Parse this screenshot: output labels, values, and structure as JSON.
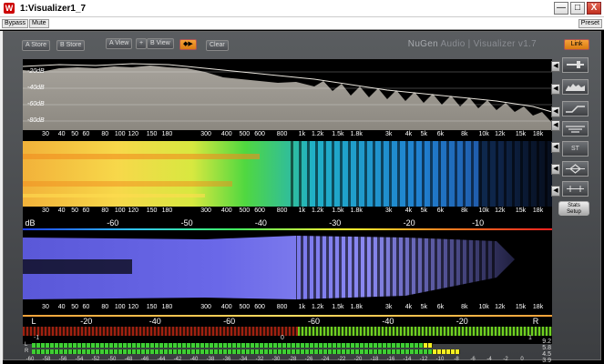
{
  "window": {
    "title": "1:Visualizer1_7",
    "logo": "W",
    "min": "—",
    "max": "□",
    "close": "X"
  },
  "host": {
    "bypass": "Bypass",
    "mute": "Mute",
    "preset": "Preset"
  },
  "toolbar": {
    "a_store": "A Store",
    "b_store": "B Store",
    "a_view": "A View",
    "plus": "+",
    "b_view": "B View",
    "swap": "◆▶",
    "clear": "Clear",
    "link": "Link"
  },
  "brand": {
    "nugen": "NuGen",
    "rest": " Audio | Visualizer v1.7"
  },
  "spectrum": {
    "db_labels": [
      "-20dB",
      "-40dB",
      "-60dB",
      "-80dB"
    ]
  },
  "freq_ticks": [
    "30",
    "40",
    "50",
    "60",
    "80",
    "100",
    "120",
    "150",
    "180",
    "300",
    "400",
    "500",
    "600",
    "800",
    "1k",
    "1.2k",
    "1.5k",
    "1.8k",
    "3k",
    "4k",
    "5k",
    "6k",
    "8k",
    "10k",
    "12k",
    "15k",
    "18k"
  ],
  "db_scale": {
    "label": "dB",
    "values": [
      "-60",
      "-50",
      "-40",
      "-30",
      "-20",
      "-10"
    ]
  },
  "lr_scale": {
    "left": "L",
    "right": "R",
    "values": [
      "-20",
      "-40",
      "-60",
      "-60",
      "-40",
      "-20"
    ]
  },
  "correlation": {
    "min": "-1",
    "mid": "0",
    "max": "1"
  },
  "meters": {
    "label_l": "L",
    "label_r": "R",
    "scale": [
      "-60",
      "-58",
      "-56",
      "-54",
      "-52",
      "-50",
      "-48",
      "-46",
      "-44",
      "-42",
      "-40",
      "-38",
      "-36",
      "-34",
      "-32",
      "-30",
      "-28",
      "-26",
      "-24",
      "-22",
      "-20",
      "-18",
      "-16",
      "-14",
      "-12",
      "-10",
      "-8",
      "-6",
      "-4",
      "-2",
      "0"
    ],
    "peaks": [
      "9.2",
      "5.8",
      "4.5",
      "3.9"
    ]
  },
  "side": {
    "stats": "Stats",
    "setup": "Setup",
    "st": "ST"
  }
}
